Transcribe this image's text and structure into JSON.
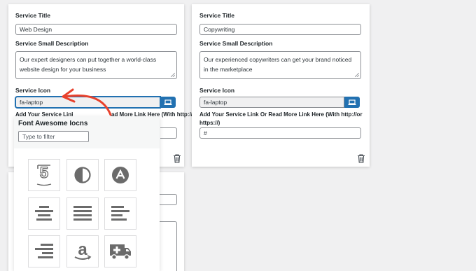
{
  "card1": {
    "title_label": "Service Title",
    "title_value": "Web Design",
    "desc_label": "Service Small Description",
    "desc_value": "Our expert designers can put together a world-class website design for your business",
    "icon_label": "Service Icon",
    "icon_value": "fa-laptop",
    "link_label_left": "Add Your Service Link Or ",
    "link_label_right": "ad More Link Here (With http://or"
  },
  "card2": {
    "title_label": "Service Title",
    "title_value": "Copywriting",
    "desc_label": "Service Small Description",
    "desc_value": "Our experienced copywriters can get your brand noticed in the marketplace",
    "icon_label": "Service Icon",
    "icon_value": "fa-laptop",
    "link_label": "Add Your Service Link Or Read More Link Here (With http://or https://)",
    "link_value": "#"
  },
  "picker": {
    "title": "Font Awesome Iocns",
    "filter_placeholder": "Type to filter",
    "icons": [
      "html5-icon",
      "adjust-icon",
      "adn-icon",
      "align-center-icon",
      "align-justify-icon",
      "align-left-icon",
      "align-right-icon",
      "amazon-icon",
      "ambulance-icon"
    ]
  },
  "colors": {
    "accent": "#2271b1",
    "arrow": "#e8412c",
    "icon_gray": "#6b6b6b"
  }
}
